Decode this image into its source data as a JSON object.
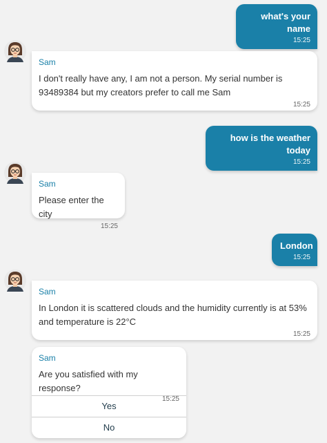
{
  "colors": {
    "user_bubble": "#1a80a8",
    "bot_bubble": "#ffffff",
    "background": "#f2f2f2",
    "sender": "#1a80a8"
  },
  "bot": {
    "name": "Sam",
    "avatar_icon": "woman-with-glasses-avatar-icon"
  },
  "messages": [
    {
      "from": "user",
      "text": "what's your name",
      "time": "15:25"
    },
    {
      "from": "bot",
      "sender": "Sam",
      "text": "I don't really have any, I am not a person. My serial number is 93489384 but my creators prefer to call me Sam",
      "time": "15:25"
    },
    {
      "from": "user",
      "text": "how is the weather today",
      "time": "15:25"
    },
    {
      "from": "bot",
      "sender": "Sam",
      "text": "Please enter the city",
      "time": "15:25"
    },
    {
      "from": "user",
      "text": "London",
      "time": "15:25"
    },
    {
      "from": "bot",
      "sender": "Sam",
      "text": "In London it is scattered clouds and the humidity currently is at 53% and temperature is 22°C",
      "time": "15:25"
    }
  ],
  "feedback": {
    "sender": "Sam",
    "text": "Are you satisfied with my response?",
    "time": "15:25",
    "options": [
      "Yes",
      "No"
    ]
  }
}
